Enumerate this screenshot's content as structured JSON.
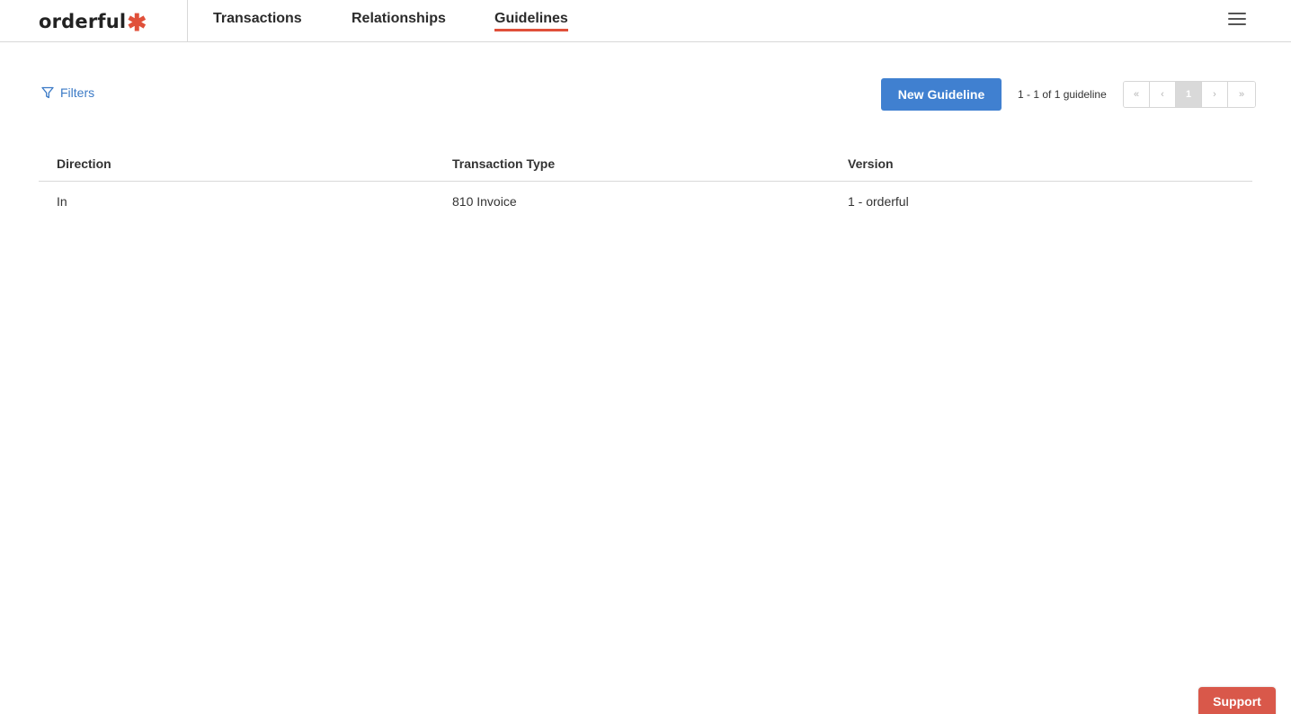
{
  "header": {
    "logo_text": "orderful",
    "logo_mark": "✱",
    "tabs": [
      {
        "label": "Transactions",
        "active": false
      },
      {
        "label": "Relationships",
        "active": false
      },
      {
        "label": "Guidelines",
        "active": true
      }
    ],
    "menu_icon": "hamburger-menu-icon"
  },
  "toolbar": {
    "filters_icon": "filter-funnel-icon",
    "filters_label": "Filters",
    "new_button_label": "New Guideline",
    "page_count_text": "1 - 1 of 1 guideline",
    "pager": {
      "first": "«",
      "prev": "‹",
      "current": "1",
      "next": "›",
      "last": "»"
    }
  },
  "table": {
    "columns": [
      "Direction",
      "Transaction Type",
      "Version"
    ],
    "rows": [
      [
        "In",
        "810 Invoice",
        "1 - orderful"
      ]
    ]
  },
  "support_label": "Support",
  "colors": {
    "accent": "#e0503a",
    "primary_button": "#4080d0",
    "link": "#3b7ac6",
    "support_button": "#d9584a"
  }
}
